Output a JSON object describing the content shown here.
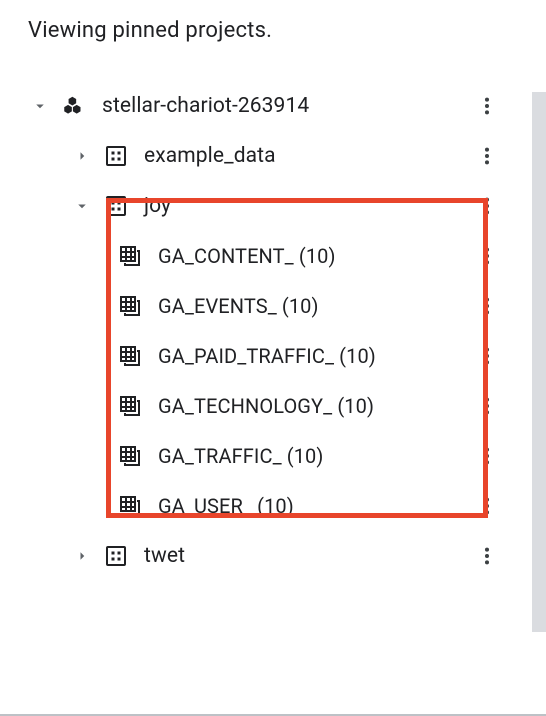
{
  "header": "Viewing pinned projects.",
  "project": {
    "name": "stellar-chariot-263914"
  },
  "datasets": [
    {
      "name": "example_data",
      "expanded": false
    },
    {
      "name": "joy",
      "expanded": true
    },
    {
      "name": "twet",
      "expanded": false
    }
  ],
  "tables": [
    {
      "name": "GA_CONTENT_",
      "count": "(10)"
    },
    {
      "name": "GA_EVENTS_",
      "count": "(10)"
    },
    {
      "name": "GA_PAID_TRAFFIC_",
      "count": "(10)"
    },
    {
      "name": "GA_TECHNOLOGY_",
      "count": "(10)"
    },
    {
      "name": "GA_TRAFFIC_",
      "count": "(10)"
    },
    {
      "name": "GA_USER_",
      "count": "(10)"
    }
  ]
}
